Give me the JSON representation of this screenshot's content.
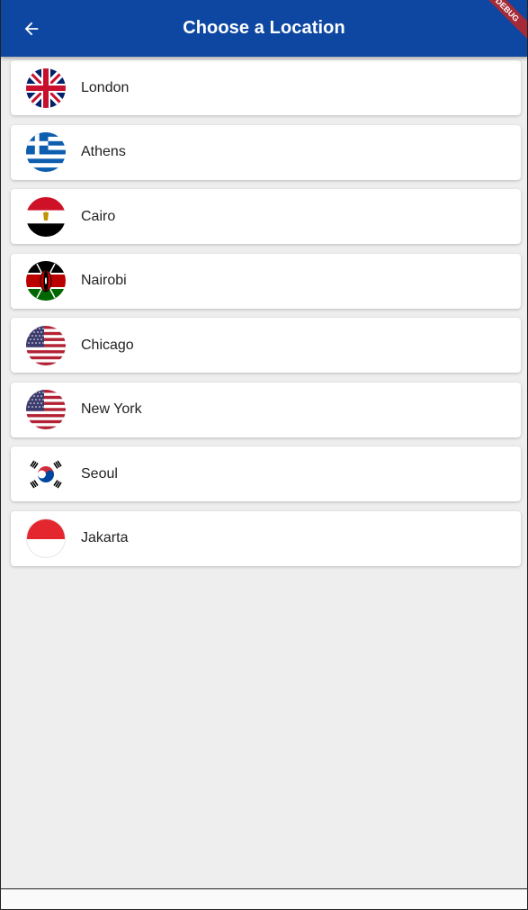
{
  "appbar": {
    "title": "Choose a Location",
    "back_icon": "arrow-left-icon",
    "background": "#0d47a1",
    "debug_banner": "DEBUG"
  },
  "locations": [
    {
      "label": "London",
      "flag": "uk-flag-icon"
    },
    {
      "label": "Athens",
      "flag": "greece-flag-icon"
    },
    {
      "label": "Cairo",
      "flag": "egypt-flag-icon"
    },
    {
      "label": "Nairobi",
      "flag": "kenya-flag-icon"
    },
    {
      "label": "Chicago",
      "flag": "usa-flag-icon"
    },
    {
      "label": "New York",
      "flag": "usa-flag-icon"
    },
    {
      "label": "Seoul",
      "flag": "south-korea-flag-icon"
    },
    {
      "label": "Jakarta",
      "flag": "indonesia-flag-icon"
    }
  ]
}
